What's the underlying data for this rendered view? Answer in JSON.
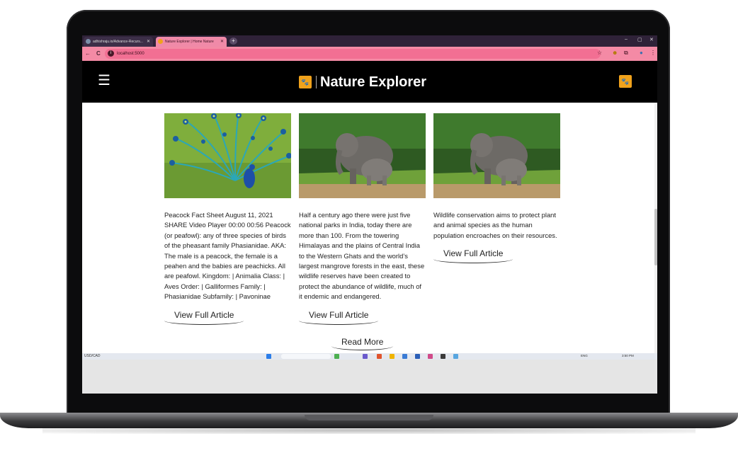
{
  "browser": {
    "tabs": [
      {
        "label": "adhishraju.io/Advance-Recurs...",
        "active": false
      },
      {
        "label": "Nature Explorer | Home Nature",
        "active": true
      }
    ],
    "new_tab": "+",
    "window_controls": [
      "–",
      "▢",
      "✕"
    ],
    "nav": {
      "back": "←",
      "forward": "→",
      "reload": "C"
    },
    "url": "localhost:5000",
    "toolbar_icons": [
      "star-icon",
      "smiley-icon",
      "extensions-icon",
      "profile-icon",
      "menu-dots-icon"
    ]
  },
  "site": {
    "menu_icon": "☰",
    "brand": "Nature Explorer",
    "accent": "#f0a21c"
  },
  "cards": [
    {
      "image": "peacock",
      "text": "Peacock Fact Sheet August 11, 2021 SHARE Video Player 00:00 00:56 Peacock (or peafowl): any of three species of birds of the pheasant family Phasianidae. AKA: The male is a peacock, the female is a peahen and the babies are peachicks. All are peafowl. Kingdom: | Animalia Class: | Aves Order: | Galliformes Family: | Phasianidae Subfamily: | Pavoninae",
      "cta": "View Full Article"
    },
    {
      "image": "elephants",
      "text": "Half a century ago there were just five national parks in India, today there are more than 100. From the towering Himalayas and the plains of Central India to the Western Ghats and the world’s largest mangrove forests in the east, these wildlife reserves have been created to protect the abundance of wildlife, much of it endemic and endangered.",
      "cta": "View Full Article"
    },
    {
      "image": "elephants",
      "text": "Wildlife conservation aims to protect plant and animal species as the human population encroaches on their resources.",
      "cta": "View Full Article"
    }
  ],
  "read_more": "Read More",
  "taskbar": {
    "left": "USD/CAD",
    "search": "Search",
    "lang": "ENG",
    "time": "3:50 PM"
  }
}
